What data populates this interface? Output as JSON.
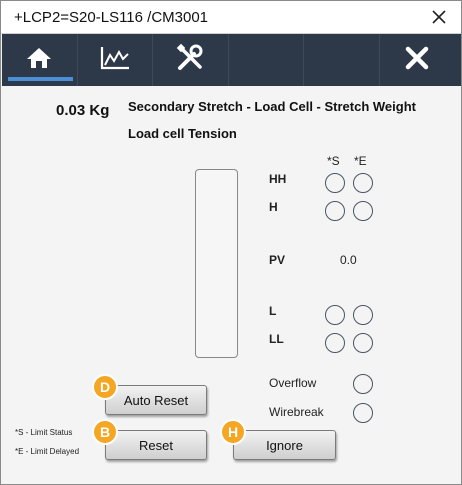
{
  "window": {
    "title": "+LCP2=S20-LS116 /CM3001"
  },
  "toolbar": {
    "items": [
      {
        "icon": "home-icon"
      },
      {
        "icon": "trend-chart-icon"
      },
      {
        "icon": "tools-icon"
      },
      {
        "icon": ""
      },
      {
        "icon": ""
      },
      {
        "icon": "close-icon"
      }
    ]
  },
  "panel": {
    "weight_value": "0.03 Kg",
    "title": "Secondary Stretch - Load Cell - Stretch Weight",
    "subtitle": "Load cell Tension",
    "col_s": "*S",
    "col_e": "*E",
    "hh_label": "HH",
    "h_label": "H",
    "pv_label": "PV",
    "pv_value": "0.0",
    "l_label": "L",
    "ll_label": "LL",
    "overflow_label": "Overflow",
    "wirebreak_label": "Wirebreak"
  },
  "buttons": {
    "auto_reset": "Auto Reset",
    "reset": "Reset",
    "ignore": "Ignore",
    "badge_auto_reset": "D",
    "badge_reset": "B",
    "badge_ignore": "H"
  },
  "legend": {
    "s_note": "*S - Limit Status",
    "e_note": "*E - Limit Delayed"
  },
  "colors": {
    "toolbar_bg": "#2d3849",
    "active_indicator": "#4a8fd8",
    "badge": "#f5a623"
  }
}
